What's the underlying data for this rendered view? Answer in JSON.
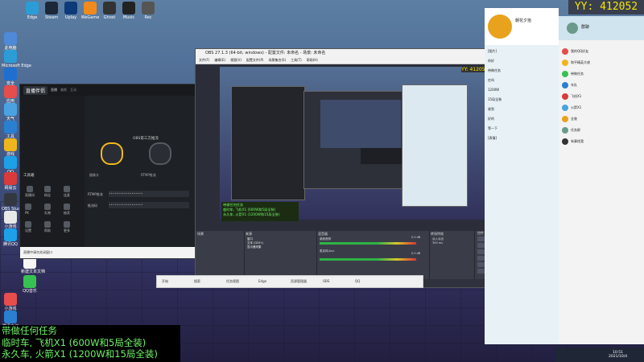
{
  "overlay": {
    "yy_label": "YY: 412052",
    "inner_yy_label": "YY: 412052",
    "task_lines": [
      "带做任何任务",
      "临时车, 飞机X1 (600W和5局全装)",
      "永久车, 火箭X1 (1200W和15局全装)"
    ],
    "inner_task_lines": [
      "带做任何任务",
      "临时车, 飞机X1 (600W和5局全装)",
      "永久车, 火箭X1 (1200W和15局全装)"
    ]
  },
  "desktop_icons": [
    {
      "label": "此电脑",
      "color": "#4e8ad8"
    },
    {
      "label": "Microsoft Edge",
      "color": "#2c9cd6"
    },
    {
      "label": "安全",
      "color": "#1f6fd0"
    },
    {
      "label": "应用",
      "color": "#e64d4d"
    },
    {
      "label": "天气",
      "color": "#4aa3e0"
    },
    {
      "label": "工具",
      "color": "#2a7fd0"
    },
    {
      "label": "游戏",
      "color": "#f0b51c"
    },
    {
      "label": "QQ",
      "color": "#1ea0e8"
    },
    {
      "label": "网易云",
      "color": "#d93a3a"
    },
    {
      "label": "OBS Studio",
      "color": "#333840"
    },
    {
      "label": "小游戏",
      "color": "#e8e8e8"
    },
    {
      "label": "腾讯QQ",
      "color": "#1ea0e8"
    },
    {
      "label": "新建文本文档",
      "color": "#f6f6f6"
    },
    {
      "label": "QQ音乐",
      "color": "#37c152"
    },
    {
      "label": "小游戏",
      "color": "#e64d4d"
    },
    {
      "label": "腾讯会议",
      "color": "#2a7fd0"
    }
  ],
  "top_icons": [
    {
      "label": "Edge",
      "color": "#2c9cd6"
    },
    {
      "label": "Steam",
      "color": "#1b2838"
    },
    {
      "label": "Uplay",
      "color": "#0d3a78"
    },
    {
      "label": "WeGame",
      "color": "#f08a1c"
    },
    {
      "label": "Ghost",
      "color": "#333"
    },
    {
      "label": "Music",
      "color": "#222"
    },
    {
      "label": "Rec",
      "color": "#555"
    }
  ],
  "zb_window": {
    "brand": "直播伴侣",
    "tabs": [
      "直播",
      "美颜",
      "互动"
    ],
    "camera_label": "摄像头",
    "obs_label": "OBS第三方推流",
    "rtmp_label": "RTMP推流",
    "rtmp_value": "••••••••••••••••••",
    "key_label": "推流码",
    "key_value": "••••••••••••••••••",
    "left_title": "工具箱",
    "grid_labels": [
      "直播间",
      "粉丝",
      "连麦",
      "PK",
      "礼物",
      "抽奖",
      "设置",
      "帮助",
      "更多"
    ],
    "footer": "直播中请勿关闭窗口"
  },
  "obs_window": {
    "title": "OBS 27.1.3 (64-bit, windows) - 配置文件: 未命名 - 场景: 未命名",
    "menu": [
      "文件(F)",
      "编辑(E)",
      "视图(V)",
      "配置文件(P)",
      "场景集合(S)",
      "工具(T)",
      "帮助(H)"
    ],
    "docks": [
      "场景",
      "来源",
      "混音器",
      "转场特效",
      "控件"
    ],
    "sources": [
      "窗口",
      "文本 (GDI+)",
      "显示器采集"
    ],
    "mixer": [
      "桌面音频",
      "麦克风/Aux"
    ],
    "mixer_db": [
      "0.0 dB",
      "0.0 dB"
    ],
    "transition": "淡入淡出",
    "duration": "300 ms",
    "controls": [
      "开始推流",
      "开始录制",
      "启动虚拟摄像机",
      "工作室模式",
      "设置",
      "退出"
    ],
    "status": "LIVE: 00:00:00   REC: 00:00:00   CPU: 2.5%, 60.00 fps"
  },
  "taskbar_inner": {
    "items": [
      "开始",
      "搜索",
      "任务视图",
      "Edge",
      "资源管理器",
      "OBS",
      "QQ"
    ]
  },
  "qq_mini": {
    "name": "朝花夕拾",
    "rows": [
      "[图片]",
      "你好",
      "带做任务",
      "在吗",
      "1200W",
      "15局全装",
      "收到",
      "好的",
      "等一下",
      "[表情]"
    ]
  },
  "qq_group": {
    "name": "群聊",
    "members": [
      "我的QQ好友",
      "和平精英大佬",
      "带做任务",
      "车队",
      "飞机X1",
      "火箭X1",
      "全装",
      "任务群",
      "有事找我"
    ]
  },
  "clock": {
    "time": "10:51",
    "date": "2021/10/4"
  },
  "colors": {
    "accent_green": "#6ff268",
    "yy_yellow": "#f4e600",
    "obs_dark": "#2b2e38"
  }
}
